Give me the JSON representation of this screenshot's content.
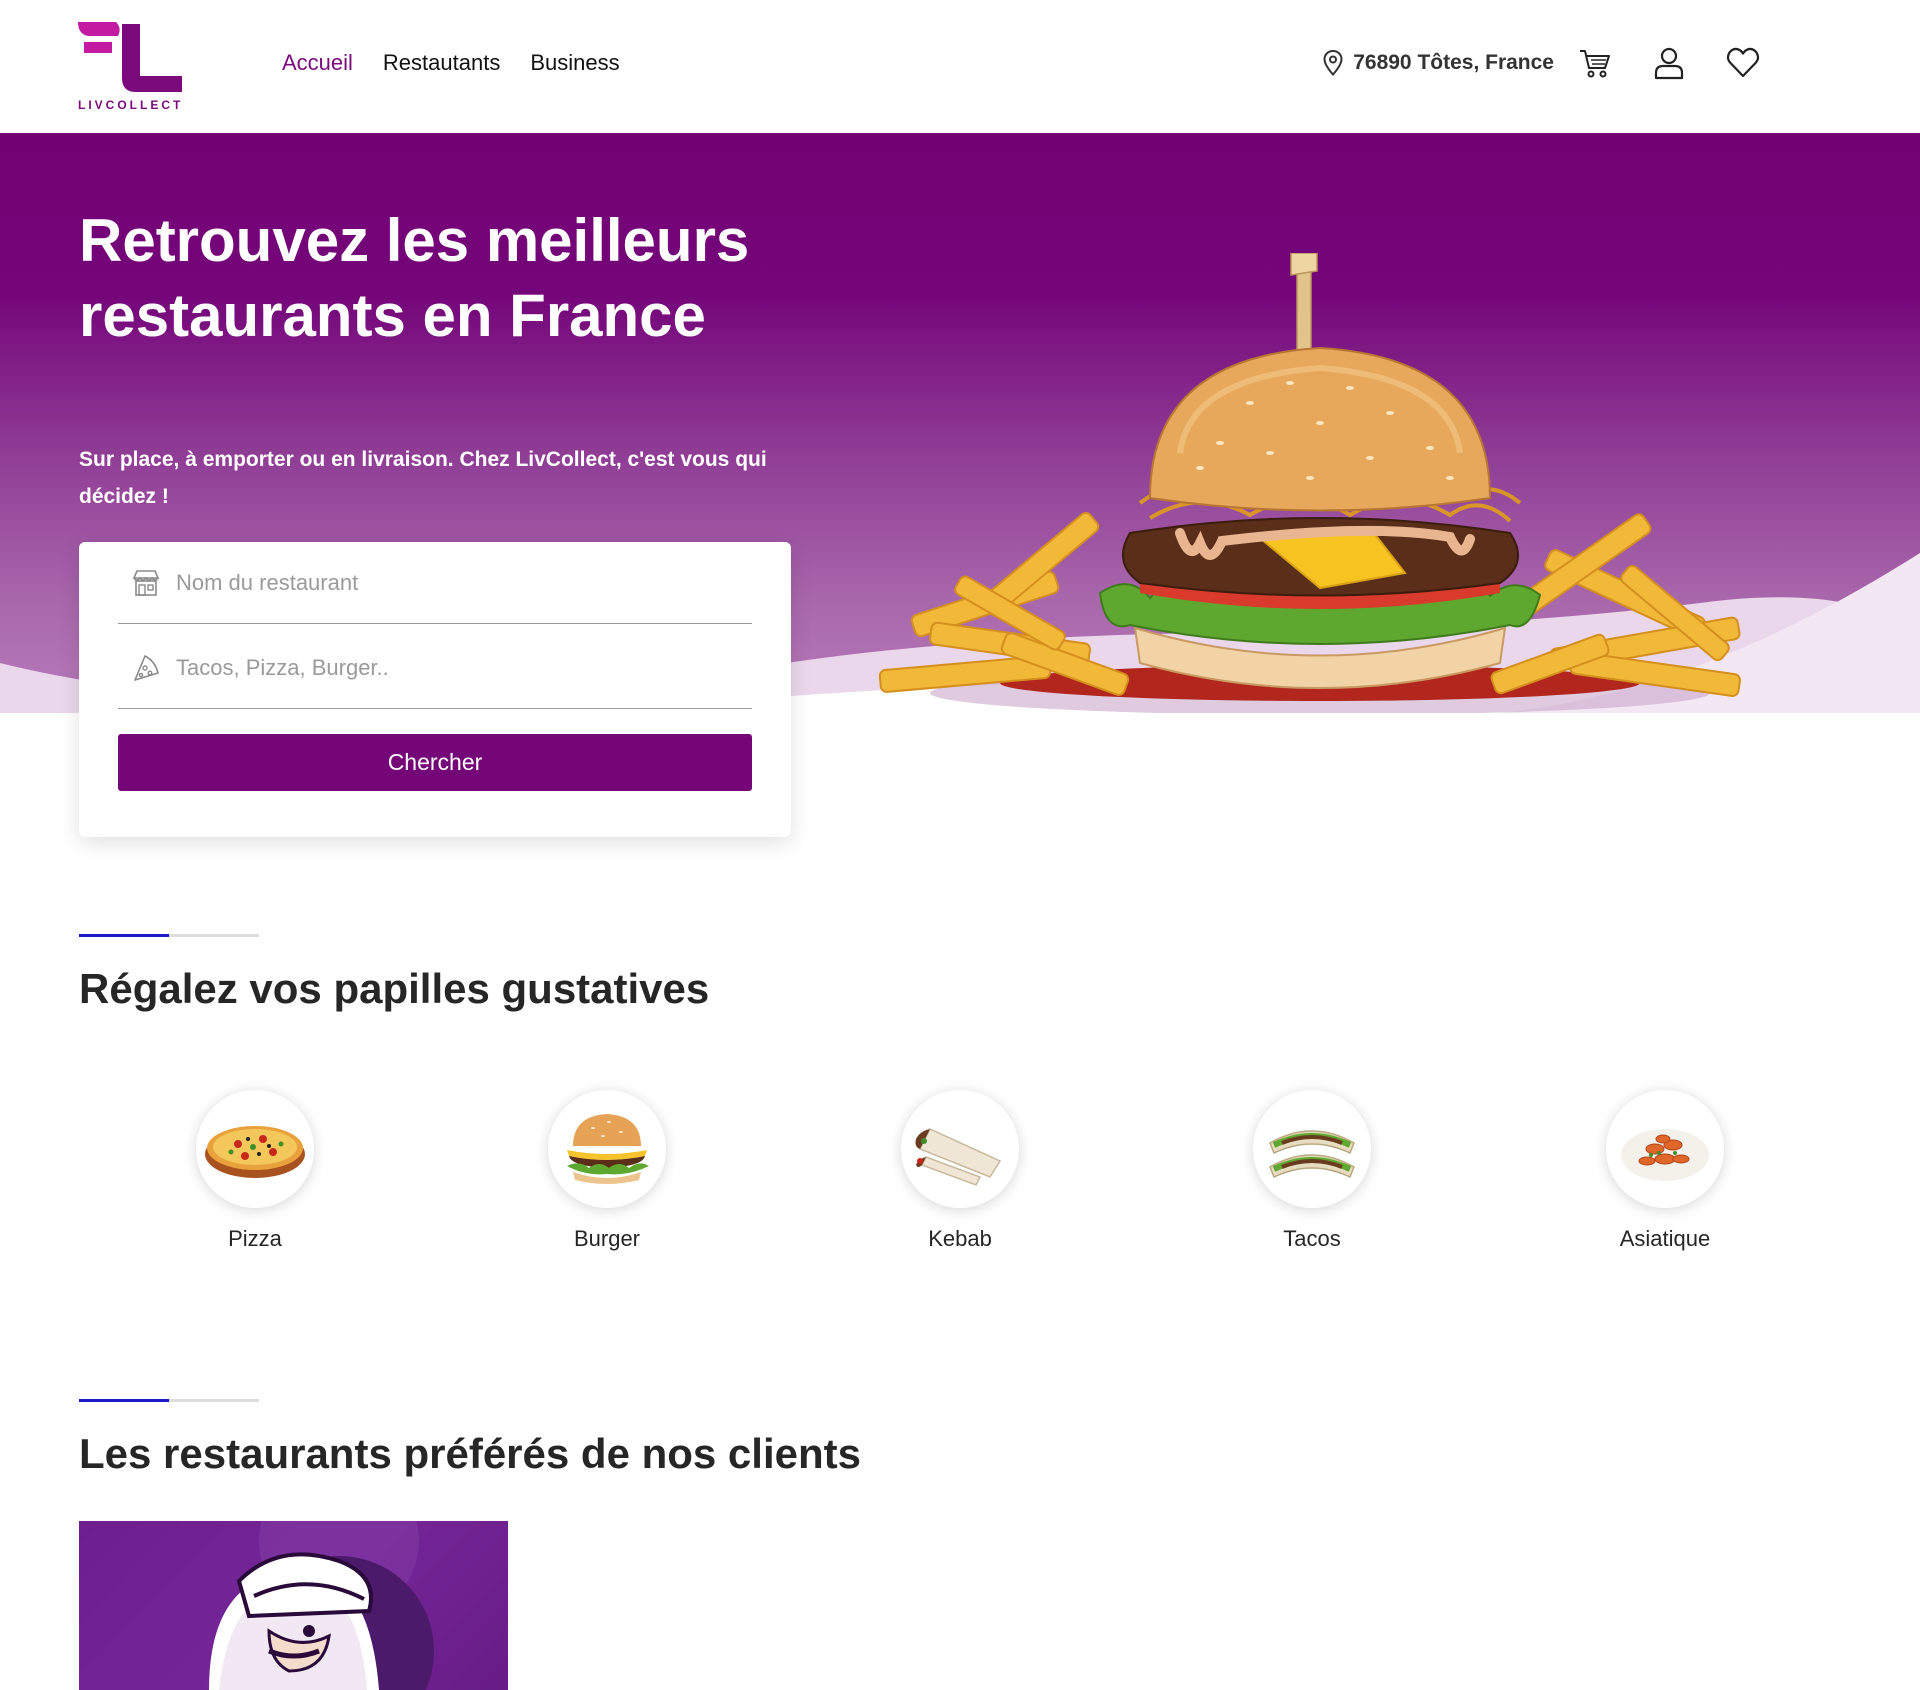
{
  "header": {
    "logo_text": "LIVCOLLECT",
    "nav": [
      {
        "label": "Accueil",
        "active": true
      },
      {
        "label": "Restautants",
        "active": false
      },
      {
        "label": "Business",
        "active": false
      }
    ],
    "location": "76890 Tôtes, France",
    "icons": [
      "map-pin-icon",
      "cart-icon",
      "user-icon",
      "heart-icon"
    ]
  },
  "hero": {
    "title": "Retrouvez les meilleurs restaurants en France",
    "subtitle": "Sur place, à emporter ou en livraison. Chez LivCollect, c'est vous qui décidez !"
  },
  "search": {
    "restaurant_placeholder": "Nom du restaurant",
    "food_placeholder": "Tacos, Pizza, Burger..",
    "button_label": "Chercher"
  },
  "categories_section": {
    "title": "Régalez vos papilles gustatives",
    "items": [
      {
        "label": "Pizza"
      },
      {
        "label": "Burger"
      },
      {
        "label": "Kebab"
      },
      {
        "label": "Tacos"
      },
      {
        "label": "Asiatique"
      }
    ]
  },
  "favorites_section": {
    "title": "Les restaurants préférés de nos clients"
  },
  "colors": {
    "brand": "#740677",
    "accent_line": "#1a1ac8"
  }
}
